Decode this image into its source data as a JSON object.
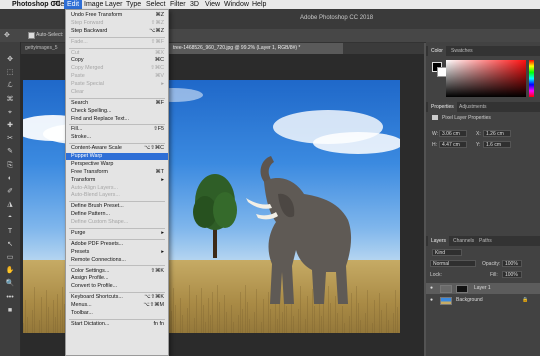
{
  "menubar": {
    "apple": "",
    "app": "Photoshop CC",
    "items": [
      "File",
      "Edit",
      "Image",
      "Layer",
      "Type",
      "Select",
      "Filter",
      "3D",
      "View",
      "Window",
      "Help"
    ]
  },
  "titlebar": {
    "title": "Adobe Photoshop CC 2018"
  },
  "options": {
    "auto_select": "Auto-Select:"
  },
  "tabs": [
    {
      "label": "gettyimages_5"
    },
    {
      "label": "tree-1468526_960_720.jpg @ 99.2% (Layer 1, RGB/8#) *"
    }
  ],
  "tools": [
    "✥",
    "⬚",
    "ℒ",
    "⌘",
    "⌖",
    "✚",
    "✂",
    "✎",
    "⎘",
    "◐",
    "✐",
    "◮",
    "◓",
    "T",
    "↖",
    "▭",
    "✋",
    "🔍",
    "•••",
    "■"
  ],
  "edit_menu": {
    "items": [
      {
        "label": "Undo Free Transform",
        "shortcut": "⌘Z",
        "disabled": false
      },
      {
        "label": "Step Forward",
        "shortcut": "⇧⌘Z",
        "disabled": true
      },
      {
        "label": "Step Backward",
        "shortcut": "⌥⌘Z",
        "disabled": false
      },
      {
        "sep": true
      },
      {
        "label": "Fade...",
        "shortcut": "⇧⌘F",
        "disabled": true
      },
      {
        "sep": true
      },
      {
        "label": "Cut",
        "shortcut": "⌘X",
        "disabled": true
      },
      {
        "label": "Copy",
        "shortcut": "⌘C",
        "disabled": false
      },
      {
        "label": "Copy Merged",
        "shortcut": "⇧⌘C",
        "disabled": true
      },
      {
        "label": "Paste",
        "shortcut": "⌘V",
        "disabled": true
      },
      {
        "label": "Paste Special",
        "shortcut": "▸",
        "disabled": true
      },
      {
        "label": "Clear",
        "shortcut": "",
        "disabled": true
      },
      {
        "sep": true
      },
      {
        "label": "Search",
        "shortcut": "⌘F",
        "disabled": false
      },
      {
        "label": "Check Spelling...",
        "shortcut": "",
        "disabled": false
      },
      {
        "label": "Find and Replace Text...",
        "shortcut": "",
        "disabled": false
      },
      {
        "sep": true
      },
      {
        "label": "Fill...",
        "shortcut": "⇧F5",
        "disabled": false
      },
      {
        "label": "Stroke...",
        "shortcut": "",
        "disabled": false
      },
      {
        "sep": true
      },
      {
        "label": "Content-Aware Scale",
        "shortcut": "⌥⇧⌘C",
        "disabled": false
      },
      {
        "label": "Puppet Warp",
        "shortcut": "",
        "disabled": false,
        "highlighted": true
      },
      {
        "label": "Perspective Warp",
        "shortcut": "",
        "disabled": false
      },
      {
        "label": "Free Transform",
        "shortcut": "⌘T",
        "disabled": false
      },
      {
        "label": "Transform",
        "shortcut": "▸",
        "disabled": false
      },
      {
        "label": "Auto-Align Layers...",
        "shortcut": "",
        "disabled": true
      },
      {
        "label": "Auto-Blend Layers...",
        "shortcut": "",
        "disabled": true
      },
      {
        "sep": true
      },
      {
        "label": "Define Brush Preset...",
        "shortcut": "",
        "disabled": false
      },
      {
        "label": "Define Pattern...",
        "shortcut": "",
        "disabled": false
      },
      {
        "label": "Define Custom Shape...",
        "shortcut": "",
        "disabled": true
      },
      {
        "sep": true
      },
      {
        "label": "Purge",
        "shortcut": "▸",
        "disabled": false
      },
      {
        "sep": true
      },
      {
        "label": "Adobe PDF Presets...",
        "shortcut": "",
        "disabled": false
      },
      {
        "label": "Presets",
        "shortcut": "▸",
        "disabled": false
      },
      {
        "label": "Remote Connections...",
        "shortcut": "",
        "disabled": false
      },
      {
        "sep": true
      },
      {
        "label": "Color Settings...",
        "shortcut": "⇧⌘K",
        "disabled": false
      },
      {
        "label": "Assign Profile...",
        "shortcut": "",
        "disabled": false
      },
      {
        "label": "Convert to Profile...",
        "shortcut": "",
        "disabled": false
      },
      {
        "sep": true
      },
      {
        "label": "Keyboard Shortcuts...",
        "shortcut": "⌥⇧⌘K",
        "disabled": false
      },
      {
        "label": "Menus...",
        "shortcut": "⌥⇧⌘M",
        "disabled": false
      },
      {
        "label": "Toolbar...",
        "shortcut": "",
        "disabled": false
      },
      {
        "sep": true
      },
      {
        "label": "Start Dictation...",
        "shortcut": "fn fn",
        "disabled": false
      }
    ]
  },
  "color_panel": {
    "tabs": [
      "Color",
      "Swatches"
    ]
  },
  "properties_panel": {
    "tabs": [
      "Properties",
      "Adjustments"
    ],
    "heading": "Pixel Layer Properties",
    "w_label": "W:",
    "w_value": "3.06 cm",
    "h_label": "H:",
    "h_value": "4.47 cm",
    "x_label": "X:",
    "x_value": "1.26 cm",
    "y_label": "Y:",
    "y_value": "1.6 cm"
  },
  "layers_panel": {
    "tabs": [
      "Layers",
      "Channels",
      "Paths"
    ],
    "kind": "Kind",
    "blend_mode": "Normal",
    "opacity_label": "Opacity:",
    "opacity_value": "100%",
    "lock_label": "Lock:",
    "fill_label": "Fill:",
    "fill_value": "100%",
    "layers": [
      {
        "name": "Layer 1",
        "selected": true
      },
      {
        "name": "Background",
        "selected": false
      }
    ]
  },
  "colors": {
    "highlight": "#2f6fd6",
    "menu_bg": "#e4e4e4"
  }
}
